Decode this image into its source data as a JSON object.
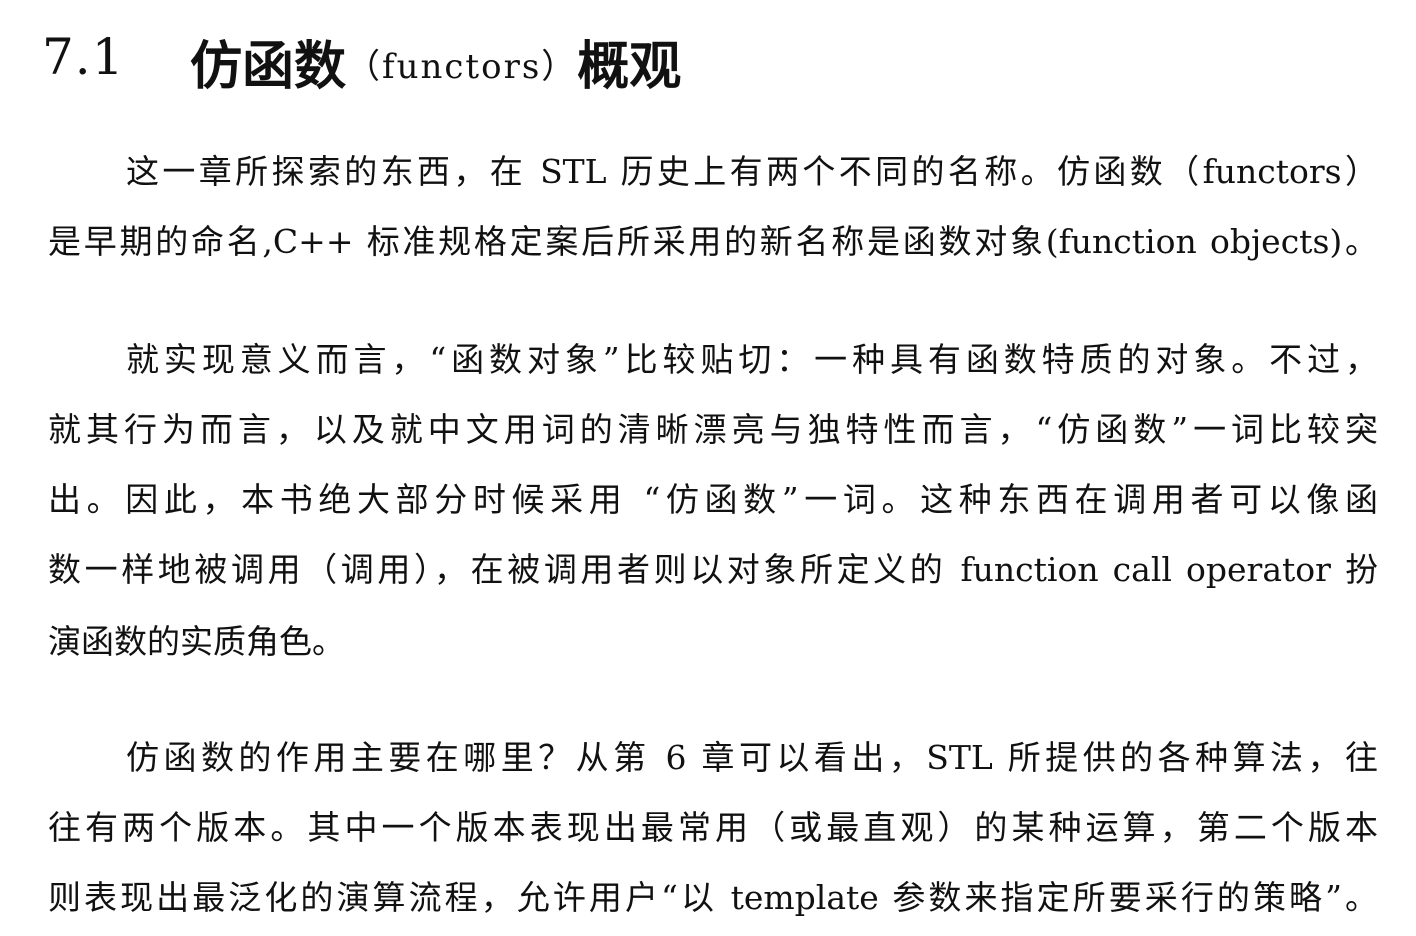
{
  "heading": {
    "number": "7.1",
    "title_main": "仿函数",
    "title_paren": "（functors）",
    "title_end": "概观"
  },
  "paragraphs": [
    {
      "lines": [
        "这一章所探索的东西，在 STL 历史上有两个不同的名称。仿函数（functors）",
        "是早期的命名,C++ 标准规格定案后所采用的新名称是函数对象(function objects)。"
      ]
    },
    {
      "lines": [
        "就实现意义而言，“函数对象”比较贴切：一种具有函数特质的对象。不过，",
        "就其行为而言，以及就中文用词的清晰漂亮与独特性而言，“仿函数”一词比较突",
        "出。因此，本书绝大部分时候采用 “仿函数”一词。这种东西在调用者可以像函",
        "数一样地被调用（调用），在被调用者则以对象所定义的 function call operator 扮",
        "演函数的实质角色。"
      ]
    },
    {
      "lines": [
        "仿函数的作用主要在哪里？从第 6 章可以看出，STL 所提供的各种算法，往",
        "往有两个版本。其中一个版本表现出最常用（或最直观）的某种运算，第二个版本",
        "则表现出最泛化的演算流程，允许用户“以 template 参数来指定所要采行的策略”。"
      ]
    }
  ]
}
